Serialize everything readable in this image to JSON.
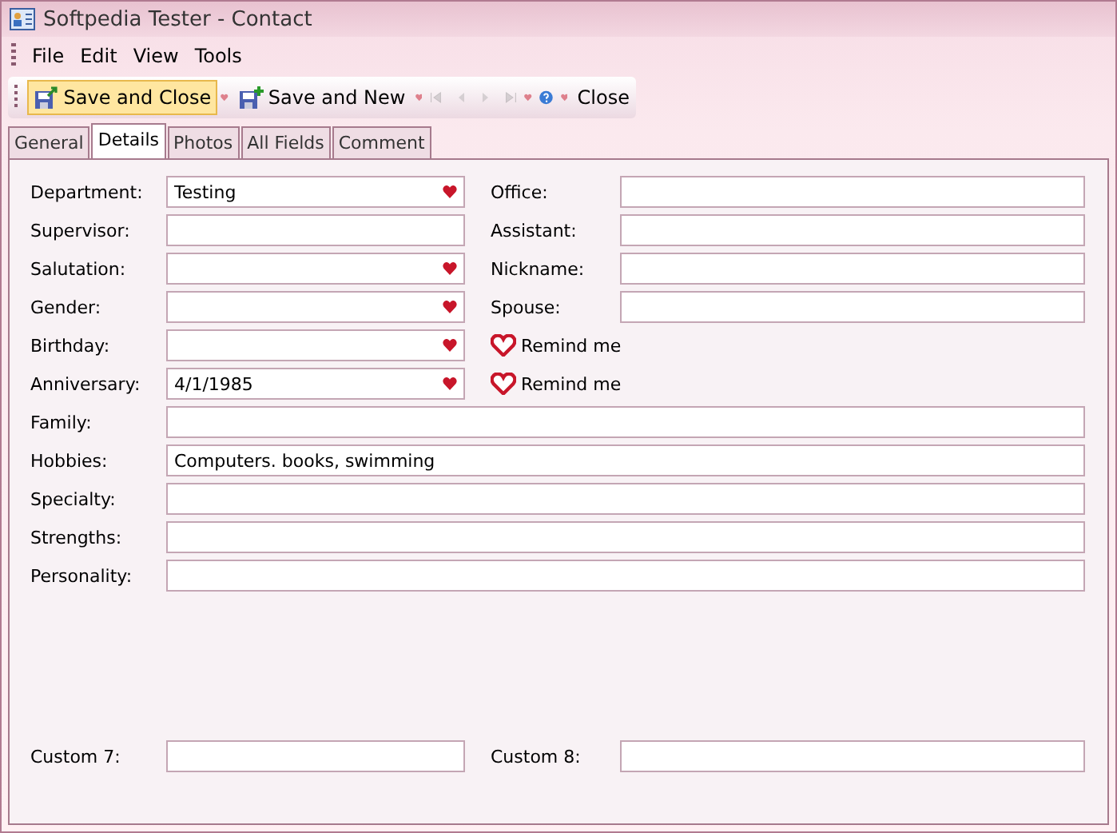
{
  "window": {
    "title": "Softpedia Tester - Contact"
  },
  "menu": [
    "File",
    "Edit",
    "View",
    "Tools"
  ],
  "toolbar": [
    {
      "kind": "save-close",
      "label": "Save and Close",
      "highlighted": true
    },
    {
      "kind": "save-new",
      "label": "Save and New",
      "highlighted": false
    },
    {
      "kind": "first",
      "disabled": true
    },
    {
      "kind": "prev",
      "disabled": true
    },
    {
      "kind": "next",
      "disabled": true
    },
    {
      "kind": "last",
      "disabled": true
    },
    {
      "kind": "help",
      "disabled": false
    },
    {
      "kind": "close",
      "label": "Close",
      "highlighted": false
    }
  ],
  "tabs": [
    {
      "label": "General",
      "selected": false
    },
    {
      "label": "Details",
      "selected": true
    },
    {
      "label": "Photos",
      "selected": false
    },
    {
      "label": "All Fields",
      "selected": false
    },
    {
      "label": "Comment",
      "selected": false
    }
  ],
  "rows": [
    {
      "kind": "pair",
      "left": {
        "label": "Department:",
        "value": "Testing",
        "dropdown": true
      },
      "right": {
        "kind": "field",
        "label": "Office:"
      }
    },
    {
      "kind": "pair",
      "left": {
        "label": "Supervisor:",
        "dropdown": false
      },
      "right": {
        "kind": "field",
        "label": "Assistant:"
      }
    },
    {
      "kind": "pair",
      "left": {
        "label": "Salutation:",
        "dropdown": true
      },
      "right": {
        "kind": "field",
        "label": "Nickname:"
      }
    },
    {
      "kind": "pair",
      "left": {
        "label": "Gender:",
        "dropdown": true
      },
      "right": {
        "kind": "field",
        "label": "Spouse:"
      }
    },
    {
      "kind": "pair",
      "left": {
        "label": "Birthday:",
        "dropdown": true
      },
      "right": {
        "kind": "remind",
        "label": "Remind me"
      }
    },
    {
      "kind": "pair",
      "left": {
        "label": "Anniversary:",
        "value": "4/1/1985",
        "dropdown": true
      },
      "right": {
        "kind": "remind",
        "label": "Remind me"
      }
    },
    {
      "kind": "full",
      "label": "Family:"
    },
    {
      "kind": "full",
      "label": "Hobbies:",
      "value": "Computers. books, swimming"
    },
    {
      "kind": "full",
      "label": "Specialty:"
    },
    {
      "kind": "full",
      "label": "Strengths:"
    },
    {
      "kind": "full",
      "label": "Personality:"
    }
  ],
  "custom": {
    "kind": "pair",
    "left": {
      "label": "Custom 7:",
      "dropdown": false
    },
    "right": {
      "kind": "field",
      "label": "Custom 8:"
    }
  }
}
